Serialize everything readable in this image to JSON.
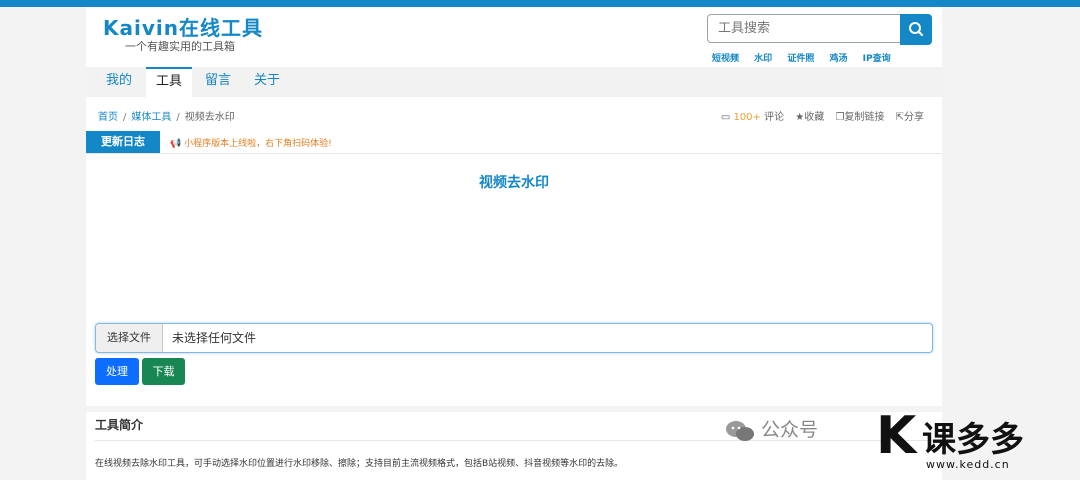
{
  "header": {
    "logo_title": "Kaivin在线工具",
    "logo_subtitle": "一个有趣实用的工具箱",
    "search_placeholder": "工具搜索",
    "quick_links": [
      "短视频",
      "水印",
      "证件照",
      "鸡汤",
      "IP查询"
    ]
  },
  "tabs": [
    {
      "label": "我的",
      "active": false
    },
    {
      "label": "工具",
      "active": true
    },
    {
      "label": "留言",
      "active": false
    },
    {
      "label": "关于",
      "active": false
    }
  ],
  "breadcrumb": {
    "home": "首页",
    "category": "媒体工具",
    "current": "视频去水印"
  },
  "actions": {
    "comment_count": "100+",
    "comment_label": "评论",
    "favorite": "收藏",
    "copy_link": "复制链接",
    "share": "分享"
  },
  "changelog": {
    "label": "更新日志",
    "text": "小程序版本上线啦，右下角扫码体验!"
  },
  "tool": {
    "title": "视频去水印",
    "file_button": "选择文件",
    "file_status": "未选择任何文件",
    "process_label": "处理",
    "download_label": "下载"
  },
  "intro": {
    "title": "工具简介",
    "text": "在线视频去除水印工具，可手动选择水印位置进行水印移除、擦除；支持目前主流视频格式，包括B站视频、抖音视频等水印的去除。"
  },
  "watermark": {
    "wechat": "公众号",
    "brand": "课多多",
    "url": "www.kedd.cn"
  },
  "colors": {
    "accent": "#1487c7",
    "process": "#0d6efd",
    "download": "#198754",
    "notice": "#e67e22"
  }
}
